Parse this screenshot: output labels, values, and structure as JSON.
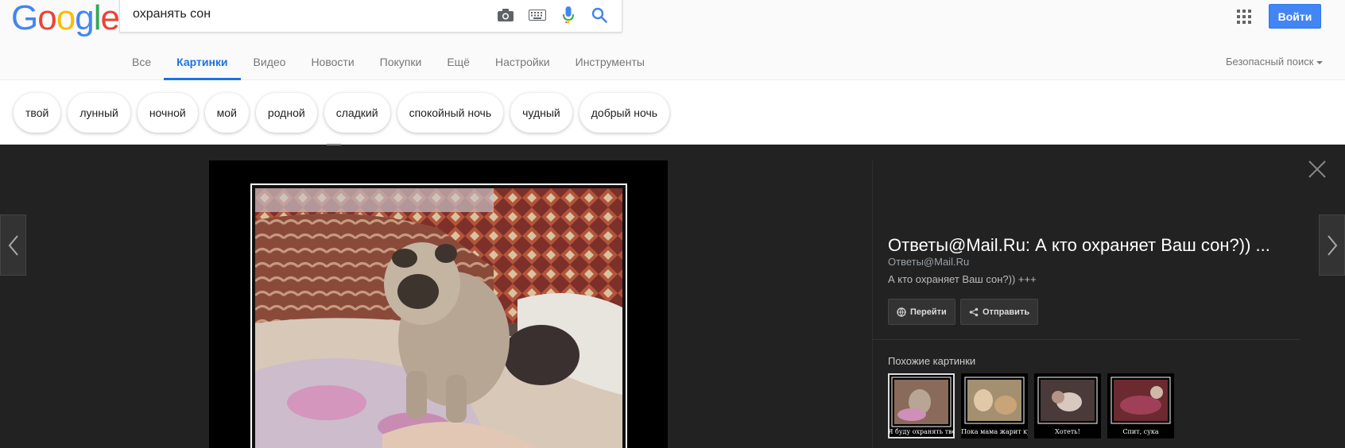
{
  "brand": {
    "logo_letters": [
      "G",
      "o",
      "o",
      "g",
      "l",
      "e"
    ],
    "logo_colors": [
      "#4285f4",
      "#ea4335",
      "#fbbc05",
      "#4285f4",
      "#34a853",
      "#ea4335"
    ]
  },
  "search": {
    "query": "охранять сон",
    "icons": [
      "camera-icon",
      "keyboard-icon",
      "mic-icon",
      "search-icon"
    ]
  },
  "header": {
    "signin_label": "Войти",
    "accent": "#4285f4"
  },
  "tabs": [
    {
      "label": "Все",
      "active": false
    },
    {
      "label": "Картинки",
      "active": true
    },
    {
      "label": "Видео",
      "active": false
    },
    {
      "label": "Новости",
      "active": false
    },
    {
      "label": "Покупки",
      "active": false
    },
    {
      "label": "Ещё",
      "active": false
    },
    {
      "label": "Настройки",
      "active": false
    },
    {
      "label": "Инструменты",
      "active": false
    }
  ],
  "safe_search": {
    "label": "Безопасный поиск"
  },
  "chips": [
    "твой",
    "лунный",
    "ночной",
    "мой",
    "родной",
    "сладкий",
    "спокойный ночь",
    "чудный",
    "добрый ночь"
  ],
  "viewer": {
    "title": "Ответы@Mail.Ru: А кто охраняет Ваш сон?)) ...",
    "site": "Ответы@Mail.Ru",
    "description": "А кто охраняет Ваш сон?)) +++",
    "visit_label": "Перейти",
    "share_label": "Отправить",
    "similar_label": "Похожие картинки",
    "thumbnails": [
      {
        "caption": "Я буду охранять твой сон",
        "selected": true
      },
      {
        "caption": "Пока мама жарит кур",
        "selected": false
      },
      {
        "caption": "Хотеть!",
        "selected": false
      },
      {
        "caption": "Спит, сука",
        "selected": false
      }
    ]
  }
}
